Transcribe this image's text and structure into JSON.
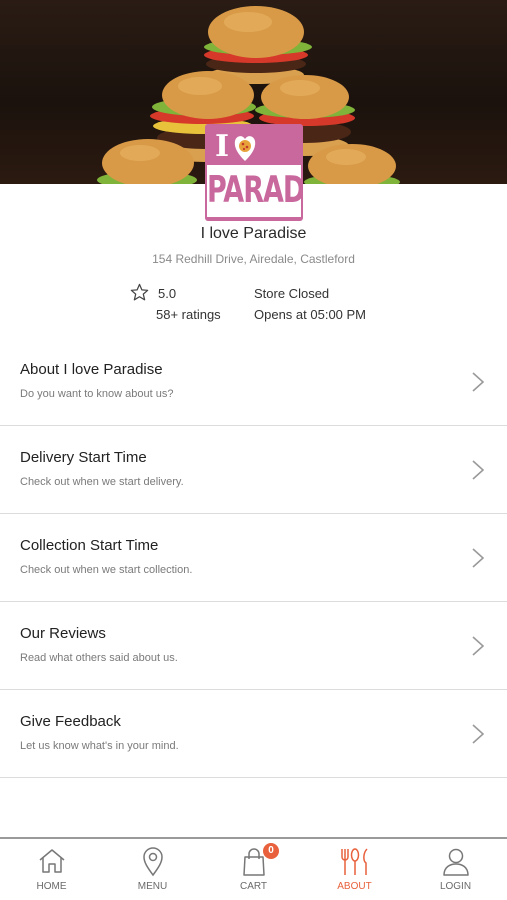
{
  "store": {
    "logo_text": "PARADISE",
    "logo_prefix": "I",
    "name": "I love Paradise",
    "address": "154 Redhill Drive, Airedale, Castleford",
    "rating": "5.0",
    "ratings_count": "58+ ratings",
    "status": "Store Closed",
    "opens": "Opens at 05:00 PM"
  },
  "menu": {
    "items": [
      {
        "title": "About I love Paradise",
        "subtitle": "Do you want to know about us?"
      },
      {
        "title": "Delivery Start Time",
        "subtitle": "Check out when we start delivery."
      },
      {
        "title": "Collection Start Time",
        "subtitle": "Check out when we start collection."
      },
      {
        "title": "Our Reviews",
        "subtitle": "Read what others said about us."
      },
      {
        "title": "Give Feedback",
        "subtitle": "Let us know what's in your mind."
      }
    ]
  },
  "tabbar": {
    "tabs": [
      {
        "label": "HOME",
        "icon": "home-icon"
      },
      {
        "label": "MENU",
        "icon": "location-pin-icon"
      },
      {
        "label": "CART",
        "icon": "shopping-bag-icon",
        "badge": "0"
      },
      {
        "label": "ABOUT",
        "icon": "cutlery-icon",
        "active": true
      },
      {
        "label": "LOGIN",
        "icon": "user-icon"
      }
    ]
  },
  "colors": {
    "accent": "#e8613c",
    "logo_pink": "#c9689d",
    "divider": "#dcdcdc"
  }
}
